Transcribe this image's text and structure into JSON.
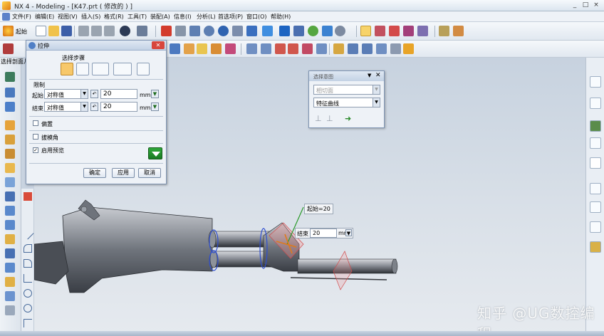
{
  "window": {
    "title": "NX 4 - Modeling - [K47.prt  ( 修改的 ) ]",
    "buttons": [
      "_",
      "□",
      "×"
    ]
  },
  "menubar": {
    "items": [
      "文件(F)",
      "编辑(E)",
      "视图(V)",
      "插入(S)",
      "格式(R)",
      "工具(T)",
      "装配(A)",
      "信息(I)",
      "分析(L)",
      "首选项(P)",
      "窗口(O)",
      "帮助(H)"
    ]
  },
  "toolbar": {
    "start_label": "起始"
  },
  "left_panel": {
    "label": "选择剖面几"
  },
  "extrude_dialog": {
    "title": "拉伸",
    "steps_label": "选择步骤",
    "limits_label": "限制",
    "start_label": "起始",
    "start_mode": "对称值",
    "start_value": "20",
    "start_unit": "mm",
    "end_label": "结束",
    "end_mode": "对称值",
    "end_value": "20",
    "end_unit": "mm",
    "offset_label": "偏置",
    "offset_checked": false,
    "draft_label": "拔模角",
    "draft_checked": false,
    "preview_label": "启用预览",
    "preview_checked": true,
    "ok_label": "确定",
    "apply_label": "应用",
    "cancel_label": "取消"
  },
  "selection_bar": {
    "title": "选择意图",
    "filter_value": "相切面",
    "curve_rule": "特征曲线"
  },
  "viewport": {
    "start_callout": "起始=20",
    "end_label": "结束",
    "end_value": "20",
    "end_unit": "mm"
  },
  "watermark": "知乎 @UG数控编程"
}
